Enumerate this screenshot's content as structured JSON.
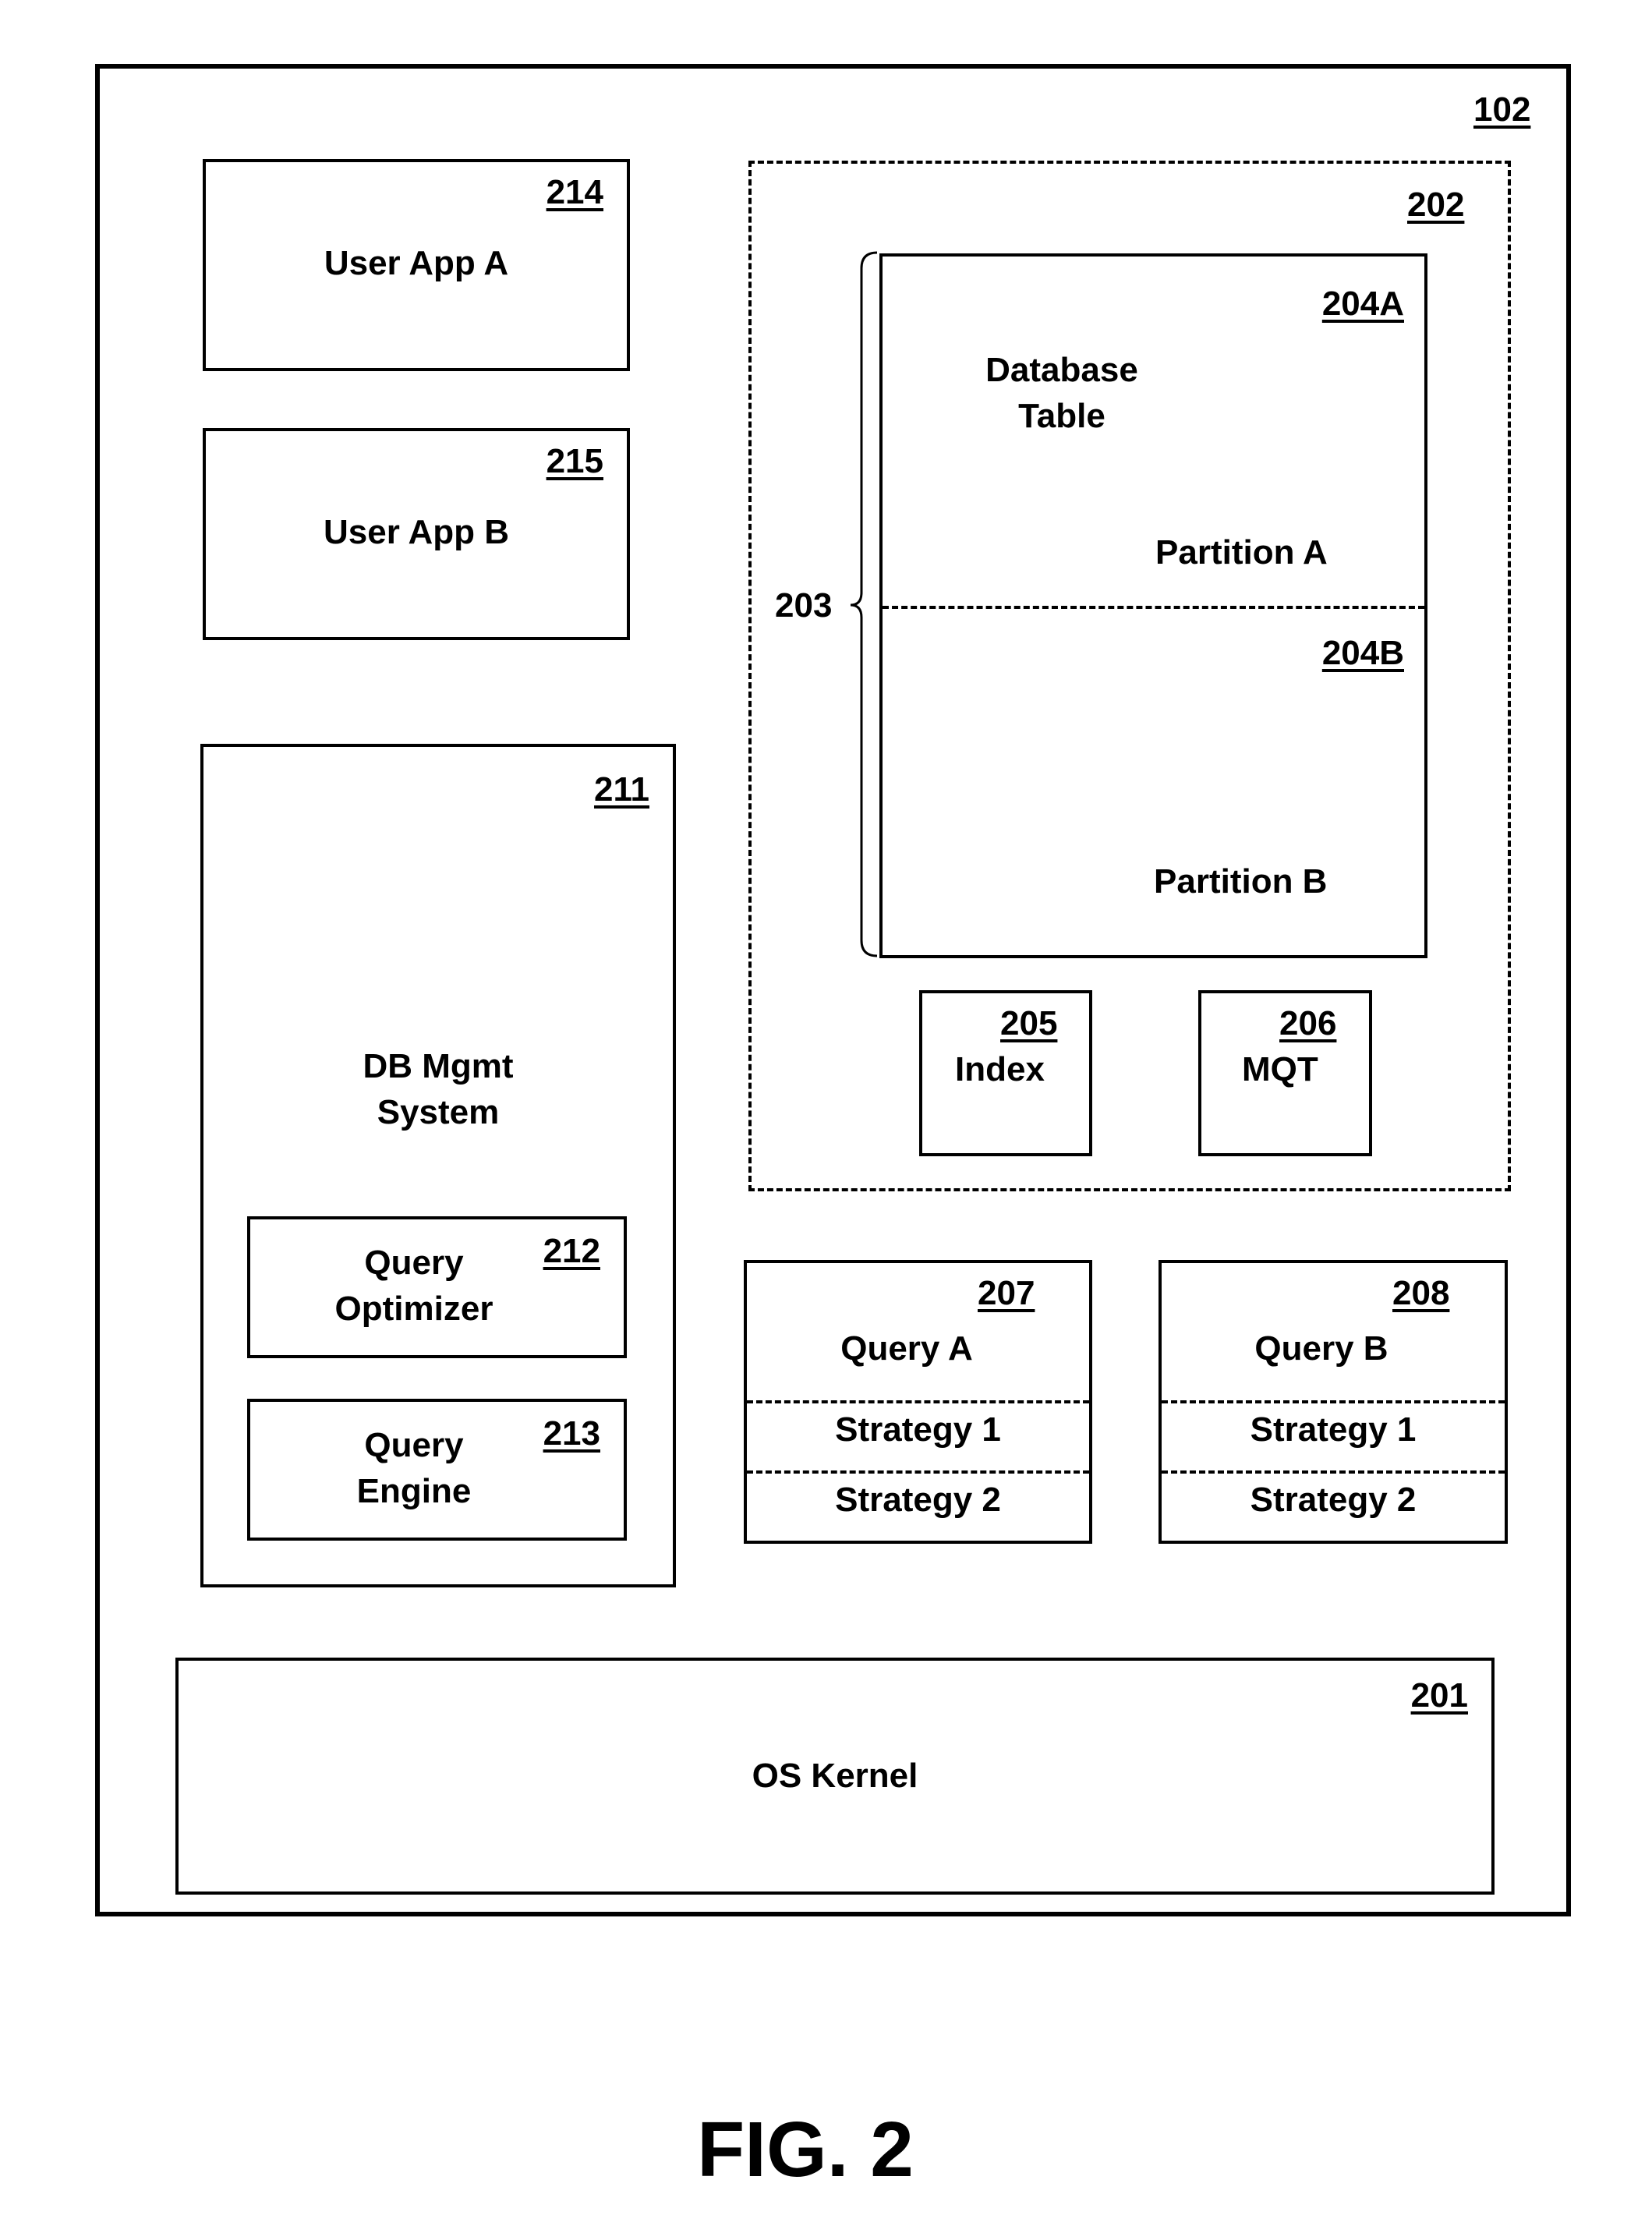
{
  "figure": {
    "caption": "FIG. 2",
    "container": {
      "ref": "102"
    },
    "user_app_a": {
      "ref": "214",
      "label": "User App A"
    },
    "user_app_b": {
      "ref": "215",
      "label": "User App B"
    },
    "dbms": {
      "ref": "211",
      "label_line1": "DB Mgmt",
      "label_line2": "System",
      "query_optimizer": {
        "ref": "212",
        "label_line1": "Query",
        "label_line2": "Optimizer"
      },
      "query_engine": {
        "ref": "213",
        "label_line1": "Query",
        "label_line2": "Engine"
      }
    },
    "database": {
      "ref": "202",
      "partition_group_ref": "203",
      "table": {
        "label_line1": "Database",
        "label_line2": "Table",
        "partition_a": {
          "ref": "204A",
          "label": "Partition A"
        },
        "partition_b": {
          "ref": "204B",
          "label": "Partition B"
        }
      },
      "index": {
        "ref": "205",
        "label": "Index"
      },
      "mqt": {
        "ref": "206",
        "label": "MQT"
      }
    },
    "query_a": {
      "ref": "207",
      "label": "Query A",
      "strategies": [
        "Strategy 1",
        "Strategy 2"
      ]
    },
    "query_b": {
      "ref": "208",
      "label": "Query B",
      "strategies": [
        "Strategy 1",
        "Strategy 2"
      ]
    },
    "os_kernel": {
      "ref": "201",
      "label": "OS Kernel"
    }
  }
}
